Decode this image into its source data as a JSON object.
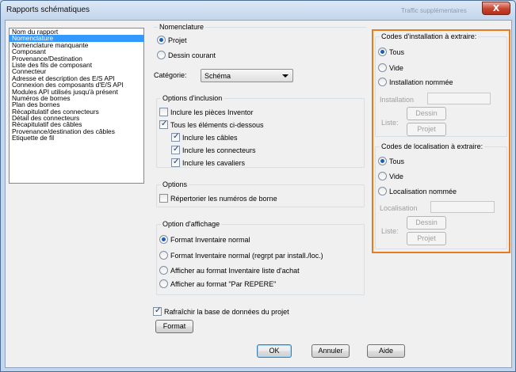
{
  "window": {
    "title": "Rapports schématiques",
    "title_ghost": "Traffic supplémentaires",
    "close_symbol": "X"
  },
  "report_list": {
    "header": "Nom du rapport",
    "items": [
      "Nomenclature",
      "Nomenclature manquante",
      "Composant",
      "Provenance/Destination",
      "Liste des fils de composant",
      "Connecteur",
      "Adresse et description des E/S API",
      "Connexion des composants d'E/S API",
      "Modules API utilisés jusqu'à présent",
      "Numéros de bornes",
      "Plan des bornes",
      "Récapitulatif des connecteurs",
      "Détail des connecteurs",
      "Récapitulatif des câbles",
      "Provenance/destination des câbles",
      "Etiquette de fil"
    ],
    "selected": "Nomenclature"
  },
  "nomenclature": {
    "title": "Nomenclature",
    "option_projet": "Projet",
    "option_dessin": "Dessin courant",
    "categorie_label": "Catégorie:",
    "categorie_value": "Schéma"
  },
  "inclusion": {
    "title": "Options d'inclusion",
    "pieces_inventor": "Inclure les pièces Inventor",
    "tous_elements": "Tous les éléments ci-dessous",
    "cables": "Inclure les câbles",
    "connecteurs": "Inclure les connecteurs",
    "cavaliers": "Inclure les cavaliers"
  },
  "options": {
    "title": "Options",
    "repertorier": "Répertorier les numéros de borne"
  },
  "affichage": {
    "title": "Option d'affichage",
    "inventaire_normal": "Format Inventaire normal",
    "inventaire_regrpt": "Format Inventaire normal (regrpt par install./loc.)",
    "liste_achat": "Afficher au format Inventaire liste d'achat",
    "par_repere": "Afficher au format \"Par REPERE\""
  },
  "refresh": {
    "label": "Rafraîchir la base de données du projet",
    "format_button": "Format"
  },
  "installation": {
    "title": "Codes d'installation à extraire:",
    "tous": "Tous",
    "vide": "Vide",
    "nommee": "Installation nommée",
    "field_label": "Installation",
    "field_value": "",
    "dessin_button": "Dessin",
    "liste_label": "Liste:",
    "projet_button": "Projet"
  },
  "localisation": {
    "title": "Codes de localisation à extraire:",
    "tous": "Tous",
    "vide": "Vide",
    "nommee": "Localisation nommée",
    "field_label": "Localisation",
    "field_value": "",
    "dessin_button": "Dessin",
    "liste_label": "Liste:",
    "projet_button": "Projet"
  },
  "footer": {
    "ok": "OK",
    "annuler": "Annuler",
    "aide": "Aide"
  },
  "colors": {
    "highlight": "#e87a1f",
    "selection": "#3399ff"
  }
}
